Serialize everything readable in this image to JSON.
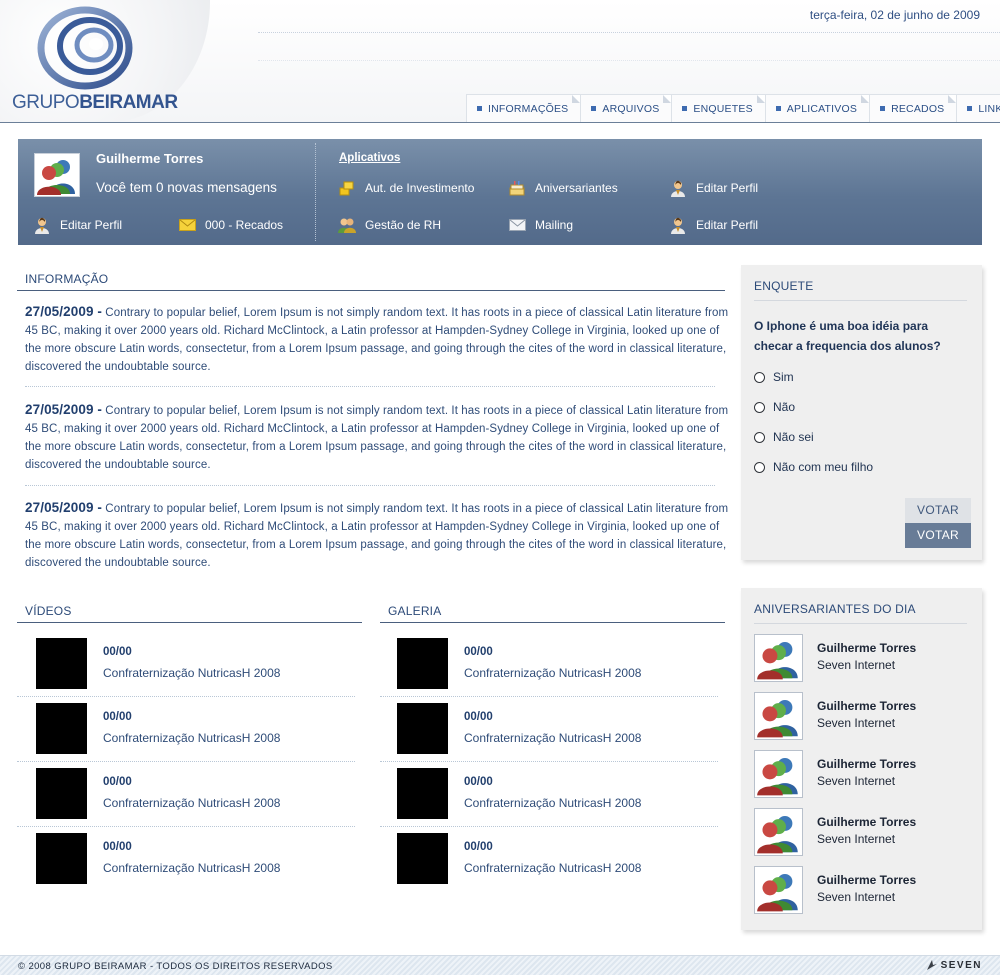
{
  "header": {
    "logo_text_light": "GRUPO",
    "logo_text_bold": "BEIRAMAR",
    "date": "terça-feira, 02 de junho de 2009",
    "nav": [
      {
        "label": "INFORMAÇÕES"
      },
      {
        "label": "ARQUIVOS"
      },
      {
        "label": "ENQUETES"
      },
      {
        "label": "APLICATIVOS"
      },
      {
        "label": "RECADOS"
      },
      {
        "label": "LINKS"
      }
    ]
  },
  "userbar": {
    "name": "Guilherme Torres",
    "messages": "Você tem 0 novas mensagens",
    "edit_profile": "Editar Perfil",
    "recados": "000 - Recados",
    "apps_title": "Aplicativos",
    "apps": [
      {
        "label": "Aut. de Investimento",
        "icon": "coins-icon"
      },
      {
        "label": "Aniversariantes",
        "icon": "cake-icon"
      },
      {
        "label": "Editar Perfil",
        "icon": "user-icon"
      },
      {
        "label": "Gestão de RH",
        "icon": "users-icon"
      },
      {
        "label": "Mailing",
        "icon": "envelope-icon"
      },
      {
        "label": "Editar Perfil",
        "icon": "user-icon"
      }
    ]
  },
  "informacao": {
    "title": "INFORMAÇÃO",
    "items": [
      {
        "date": "27/05/2009 -",
        "text": " Contrary to popular belief, Lorem Ipsum is not simply random text. It has roots in a piece of classical Latin literature from 45 BC, making it over 2000 years old. Richard McClintock, a Latin professor at Hampden-Sydney College in Virginia, looked up one of the more obscure Latin words, consectetur, from a Lorem Ipsum passage, and going through the cites of the word in classical literature, discovered the undoubtable source."
      },
      {
        "date": "27/05/2009 -",
        "text": " Contrary to popular belief, Lorem Ipsum is not simply random text. It has roots in a piece of classical Latin literature from 45 BC, making it over 2000 years old. Richard McClintock, a Latin professor at Hampden-Sydney College in Virginia, looked up one of the more obscure Latin words, consectetur, from a Lorem Ipsum passage, and going through the cites of the word in classical literature, discovered the undoubtable source."
      },
      {
        "date": "27/05/2009 -",
        "text": " Contrary to popular belief, Lorem Ipsum is not simply random text. It has roots in a piece of classical Latin literature from 45 BC, making it over 2000 years old. Richard McClintock, a Latin professor at Hampden-Sydney College in Virginia, looked up one of the more obscure Latin words, consectetur, from a Lorem Ipsum passage, and going through the cites of the word in classical literature, discovered the undoubtable source."
      }
    ]
  },
  "videos": {
    "title": "VÍDEOS",
    "items": [
      {
        "date": "00/00",
        "title": "Confraternização NutricasH 2008"
      },
      {
        "date": "00/00",
        "title": "Confraternização NutricasH 2008"
      },
      {
        "date": "00/00",
        "title": "Confraternização NutricasH 2008"
      },
      {
        "date": "00/00",
        "title": "Confraternização NutricasH 2008"
      }
    ]
  },
  "galeria": {
    "title": "GALERIA",
    "items": [
      {
        "date": "00/00",
        "title": "Confraternização NutricasH 2008"
      },
      {
        "date": "00/00",
        "title": "Confraternização NutricasH 2008"
      },
      {
        "date": "00/00",
        "title": "Confraternização NutricasH 2008"
      },
      {
        "date": "00/00",
        "title": "Confraternização NutricasH 2008"
      }
    ]
  },
  "enquete": {
    "title": "ENQUETE",
    "question": "O Iphone é uma boa idéia para checar a frequencia dos alunos?",
    "options": [
      "Sim",
      "Não",
      "Não sei",
      "Não com meu filho"
    ],
    "vote_label": "VOTAR",
    "vote_label_hover": "VOTAR"
  },
  "aniversariantes": {
    "title": "ANIVERSARIANTES DO DIA",
    "people": [
      {
        "name": "Guilherme Torres",
        "company": "Seven Internet"
      },
      {
        "name": "Guilherme Torres",
        "company": "Seven Internet"
      },
      {
        "name": "Guilherme Torres",
        "company": "Seven Internet"
      },
      {
        "name": "Guilherme Torres",
        "company": "Seven Internet"
      },
      {
        "name": "Guilherme Torres",
        "company": "Seven Internet"
      }
    ]
  },
  "footer": {
    "copyright": "© 2008 GRUPO BEIRAMAR - TODOS OS DIREITOS RESERVADOS",
    "credit": "SEVEN"
  },
  "colors": {
    "brand_blue": "#3d5f97",
    "bar_blue": "#5d7594",
    "text_blue": "#2f4c78"
  }
}
